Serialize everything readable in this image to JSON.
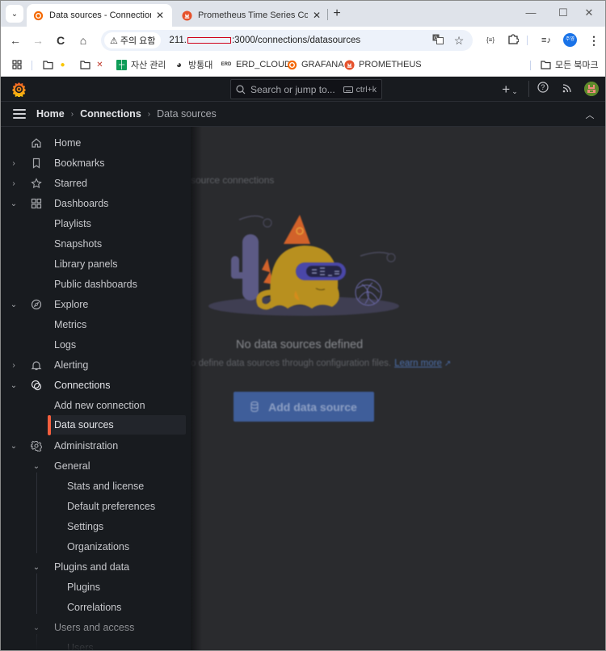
{
  "browser": {
    "tabs": [
      {
        "title": "Data sources - Connections - Grafana",
        "favicon": "grafana-icon",
        "active": true
      },
      {
        "title": "Prometheus Time Series Collection",
        "favicon": "prometheus-icon",
        "active": false
      }
    ],
    "new_tab_label": "+",
    "tab_search_icon": "chevron-down-icon",
    "window_controls": {
      "minimize": "—",
      "maximize": "☐",
      "close": "✕"
    },
    "nav": {
      "back": "←",
      "forward": "→",
      "reload": "C",
      "home": "⌂"
    },
    "security_chip": "주의 요함",
    "url_prefix": "211.",
    "url_suffix": ":3000/connections/datasources",
    "profile_label": "주영",
    "menu_icon": "⋮",
    "bookmarks": [
      {
        "label": "",
        "icon": "folder-icon",
        "extra": "lightbulb-icon"
      },
      {
        "label": "",
        "icon": "folder-icon",
        "extra": "tools-icon"
      },
      {
        "label": "자산 관리",
        "icon": "sheets-icon"
      },
      {
        "label": "방통대",
        "icon": "globe-icon"
      },
      {
        "label": "ERD_CLOUD",
        "icon": "erd-icon"
      },
      {
        "label": "GRAFANA",
        "icon": "grafana-icon"
      },
      {
        "label": "PROMETHEUS",
        "icon": "prometheus-icon"
      }
    ],
    "all_bookmarks_label": "모든 북마크"
  },
  "grafana": {
    "search": {
      "placeholder": "Search or jump to...",
      "shortcut": "ctrl+k"
    },
    "topbar_icons": [
      "plus-icon",
      "help-icon",
      "news-icon",
      "user-avatar"
    ],
    "breadcrumbs": [
      {
        "label": "Home"
      },
      {
        "label": "Connections"
      },
      {
        "label": "Data sources"
      }
    ],
    "breadcrumb_separator": "›",
    "sidebar": {
      "items": [
        {
          "label": "Home",
          "icon": "home-icon",
          "chevron": ""
        },
        {
          "label": "Bookmarks",
          "icon": "bookmark-icon",
          "chevron": "›"
        },
        {
          "label": "Starred",
          "icon": "star-icon",
          "chevron": "›"
        },
        {
          "label": "Dashboards",
          "icon": "apps-icon",
          "chevron": "⌄"
        },
        {
          "label": "Playlists"
        },
        {
          "label": "Snapshots"
        },
        {
          "label": "Library panels"
        },
        {
          "label": "Public dashboards"
        },
        {
          "label": "Explore",
          "icon": "compass-icon",
          "chevron": "⌄"
        },
        {
          "label": "Metrics"
        },
        {
          "label": "Logs"
        },
        {
          "label": "Alerting",
          "icon": "bell-icon",
          "chevron": "›"
        },
        {
          "label": "Connections",
          "icon": "connections-icon",
          "chevron": "⌄"
        },
        {
          "label": "Add new connection"
        },
        {
          "label": "Data sources",
          "active": true
        },
        {
          "label": "Administration",
          "icon": "cog-icon",
          "chevron": "⌄"
        },
        {
          "label": "General",
          "chevron": "⌄"
        },
        {
          "label": "Stats and license"
        },
        {
          "label": "Default preferences"
        },
        {
          "label": "Settings"
        },
        {
          "label": "Organizations"
        },
        {
          "label": "Plugins and data",
          "chevron": "⌄"
        },
        {
          "label": "Plugins"
        },
        {
          "label": "Correlations"
        },
        {
          "label": "Users and access",
          "chevron": "⌄"
        },
        {
          "label": "Users"
        }
      ]
    },
    "main": {
      "subtitle": "source connections",
      "empty_title": "No data sources defined",
      "empty_desc": "o define data sources through configuration files.",
      "learn_more": "Learn more",
      "add_button": "Add data source"
    },
    "colors": {
      "accent": "#f55f3e",
      "primary_button": "#3f5e9a",
      "link": "#4c6ea8",
      "background": "#181b1f",
      "canvas": "#2a2b2e"
    }
  }
}
